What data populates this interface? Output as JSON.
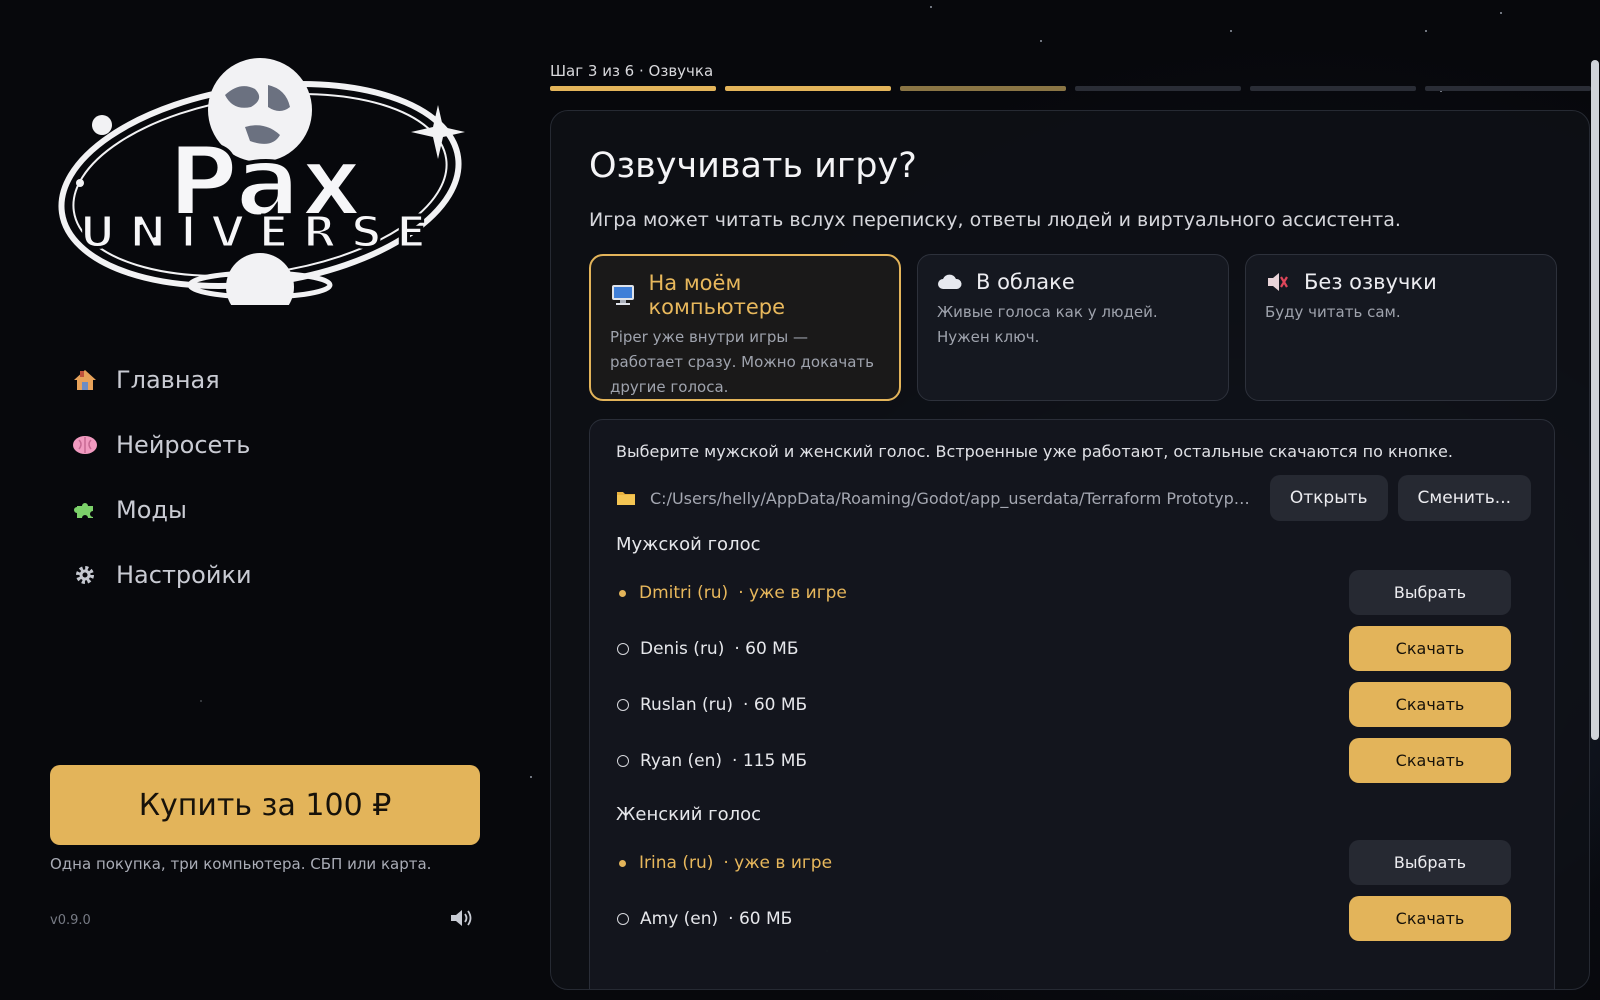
{
  "app": {
    "logo": {
      "line1": "Pax",
      "line2": "UNIVERSE"
    }
  },
  "sidebar": {
    "items": [
      {
        "label": "Главная",
        "icon": "house-icon"
      },
      {
        "label": "Нейросеть",
        "icon": "brain-icon"
      },
      {
        "label": "Моды",
        "icon": "puzzle-icon"
      },
      {
        "label": "Настройки",
        "icon": "gear-icon"
      }
    ],
    "buy_label": "Купить за 100 ₽",
    "buy_note": "Одна покупка, три компьютера. СБП или карта.",
    "version": "v0.9.0",
    "volume_icon": "speaker-icon"
  },
  "wizard": {
    "step_label": "Шаг 3 из 6 · Озвучка",
    "steps_total": 6,
    "steps_done": 2,
    "title": "Озвучивать игру?",
    "subtitle": "Игра может читать вслух переписку, ответы людей и виртуального ассистента.",
    "options": [
      {
        "title": "На моём компьютере",
        "desc": "Piper уже внутри игры — работает сразу. Можно докачать другие голоса.",
        "icon": "monitor-icon",
        "selected": true
      },
      {
        "title": "В облаке",
        "desc": "Живые голоса как у людей. Нужен ключ.",
        "icon": "cloud-icon",
        "selected": false
      },
      {
        "title": "Без озвучки",
        "desc": "Буду читать сам.",
        "icon": "muted-speaker-icon",
        "selected": false
      }
    ]
  },
  "voices": {
    "hint": "Выберите мужской и женский голос. Встроенные уже работают, остальные скачаются по кнопке.",
    "path": "C:/Users/helly/AppData/Roaming/Godot/app_userdata/Terraform Prototype/voices",
    "open_label": "Открыть",
    "change_label": "Сменить...",
    "male_label": "Мужской голос",
    "female_label": "Женский голос",
    "male": [
      {
        "name": "Dmitri  (ru)",
        "meta": "· уже в игре",
        "active": true,
        "button": "Выбрать"
      },
      {
        "name": "Denis  (ru)",
        "meta": "· 60 МБ",
        "active": false,
        "button": "Скачать"
      },
      {
        "name": "Ruslan  (ru)",
        "meta": "· 60 МБ",
        "active": false,
        "button": "Скачать"
      },
      {
        "name": "Ryan  (en)",
        "meta": "· 115 МБ",
        "active": false,
        "button": "Скачать"
      }
    ],
    "female": [
      {
        "name": "Irina  (ru)",
        "meta": "· уже в игре",
        "active": true,
        "button": "Выбрать"
      },
      {
        "name": "Amy  (en)",
        "meta": "· 60 МБ",
        "active": false,
        "button": "Скачать"
      }
    ]
  },
  "colors": {
    "accent": "#e3b45a",
    "background": "#07080c",
    "panel": "#0e1016"
  }
}
